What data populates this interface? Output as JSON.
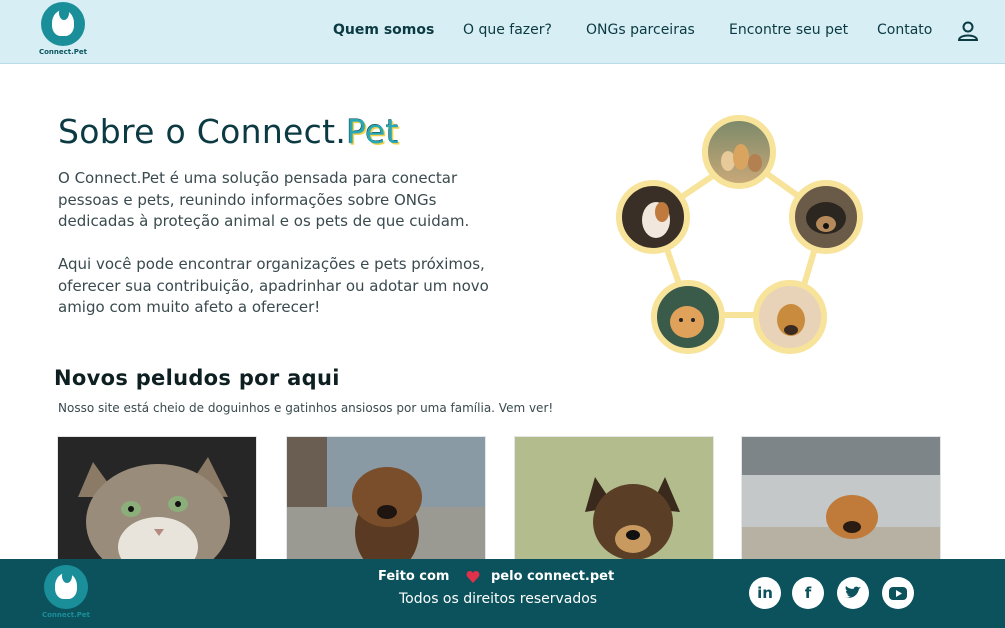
{
  "brand": {
    "logo_text": "Connect.Pet"
  },
  "nav": {
    "items": [
      "Quem somos",
      "O que fazer?",
      "ONGs parceiras",
      "Encontre seu pet",
      "Contato"
    ]
  },
  "hero": {
    "title_main": "Sobre o Connect.",
    "title_accent": "Pet",
    "paragraph_1": "O Connect.Pet é uma solução pensada para conectar pessoas e pets, reunindo informações sobre ONGs dedicadas à proteção animal e os pets de que cuidam.",
    "paragraph_2": "Aqui você pode encontrar organizações e pets próximos, oferecer sua contribuição, apadrinhar ou adotar um novo amigo com muito afeto a oferecer!"
  },
  "section": {
    "title": "Novos peludos por aqui",
    "subtitle": "Nosso site está cheio de doguinhos e gatinhos ansiosos por uma família. Vem ver!"
  },
  "footer": {
    "made_with": "Feito com",
    "made_by": "pelo connect.pet",
    "rights": "Todos os direitos reservados",
    "logo_text": "Connect.Pet",
    "social": [
      "linkedin-icon",
      "facebook-icon",
      "twitter-icon",
      "youtube-icon"
    ]
  },
  "colors": {
    "header_bg": "#d6eef4",
    "footer_bg": "#0b525d",
    "accent": "#1a8f9a",
    "ring": "#f7e39a",
    "heart": "#e0304a"
  }
}
